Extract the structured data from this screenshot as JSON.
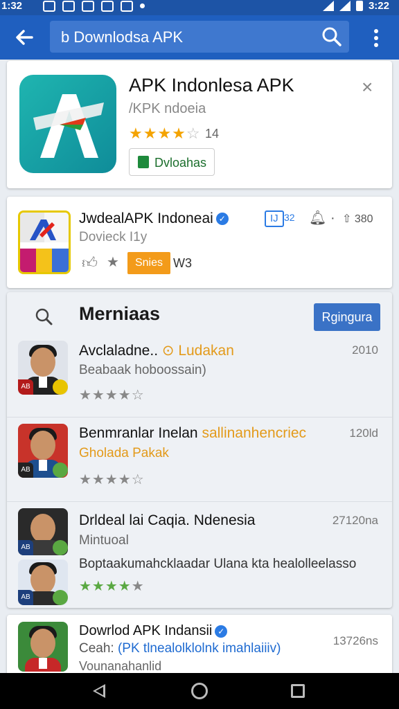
{
  "status_bar": {
    "time_left": "1:32",
    "time_right": "3:22"
  },
  "toolbar": {
    "search_query": "b Downlodsa APK"
  },
  "featured": {
    "title": "APK Indonlesa APK",
    "subtitle": "/KPK ndoeia",
    "rating_count": "14",
    "download_label": "Dvloahas",
    "close_symbol": "×"
  },
  "second_app": {
    "title": "JwdealAPK Indoneai",
    "subtitle": "Dovieck I1y",
    "tag": "IJ",
    "tag_count": "32",
    "share_count": "380",
    "chip_label": "Snies",
    "chip_after": "W3"
  },
  "section": {
    "title": "Merniaas",
    "action_label": "Rgingura",
    "rows": [
      {
        "title": "Avclaladne..",
        "title_suffix": "Ludakan",
        "subtitle": "Beabaak hoboossain)",
        "count": "2010"
      },
      {
        "title": "Benmranlar Inelan",
        "title_suffix": "sallinanhencriec",
        "subtitle": "Gholada Pakak",
        "count": "120ld"
      },
      {
        "title": "Drldeal lai Caqia. Ndenesia",
        "subtitle": "Mintuoal",
        "description": "Boptaakumahcklaadar Ulana kta healolleelasso",
        "count": "27120na"
      }
    ]
  },
  "bottom_card": {
    "title": "Dowrlod APK Indansii",
    "subtitle_prefix": "Ceah:",
    "subtitle_link": "(PK tlnealolklolnk imahlaiiiv)",
    "subtitle2": "Vounanahanlid",
    "count": "13726ns"
  }
}
